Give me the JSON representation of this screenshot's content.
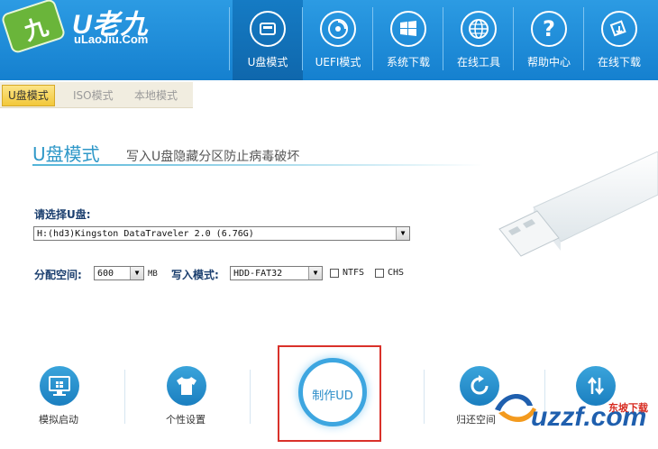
{
  "app": {
    "logo_mark": "九",
    "logo_title": "U老九",
    "logo_sub": "uLaoJiu.Com"
  },
  "nav": [
    {
      "label": "U盘模式",
      "icon": "usb-drive-icon"
    },
    {
      "label": "UEFI模式",
      "icon": "disc-icon"
    },
    {
      "label": "系统下载",
      "icon": "windows-icon"
    },
    {
      "label": "在线工具",
      "icon": "globe-icon"
    },
    {
      "label": "帮助中心",
      "icon": "question-icon"
    },
    {
      "label": "在线下载",
      "icon": "download-icon"
    }
  ],
  "tabs": [
    {
      "label": "U盘模式",
      "active": true
    },
    {
      "label": "ISO模式",
      "active": false
    },
    {
      "label": "本地模式",
      "active": false
    }
  ],
  "section": {
    "title": "U盘模式",
    "desc": "写入U盘隐藏分区防止病毒破坏"
  },
  "form": {
    "select_label": "请选择U盘:",
    "device_value": "H:(hd3)Kingston DataTraveler 2.0 (6.76G)",
    "alloc_label": "分配空间:",
    "alloc_value": "600",
    "alloc_unit": "MB",
    "write_label": "写入模式:",
    "write_value": "HDD-FAT32",
    "ntfs_label": "NTFS",
    "chs_label": "CHS"
  },
  "actions": {
    "simulate": "模拟启动",
    "personalize": "个性设置",
    "make": "制作UD",
    "restore": "归还空间"
  },
  "watermark": {
    "brand": "uzzf.com",
    "cn": "东坡下载"
  },
  "colors": {
    "header": "#1a87d3",
    "accent": "#3da6e0",
    "highlight_box": "#d9312a",
    "tab_active": "#f2c83a"
  }
}
